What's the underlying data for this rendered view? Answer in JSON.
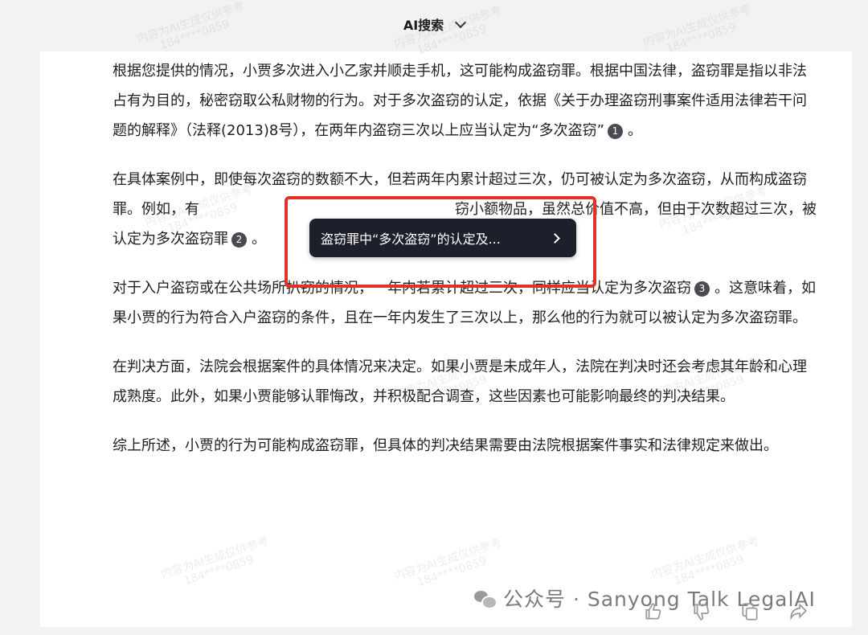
{
  "header": {
    "title": "AI搜索"
  },
  "answer": {
    "p1_text": "根据您提供的情况，小贾多次进入小乙家并顺走手机，这可能构成盗窃罪。根据中国法律，盗窃罪是指以非法占有为目的，秘密窃取公私财物的行为。对于多次盗窃的认定，依据《关于办理盗窃刑事案件适用法律若干问题的解释》（法释(2013)8号），在两年内盗窃三次以上应当认定为“多次盗窃”",
    "p1_cite": "1",
    "p1_end": "。",
    "p2_text_a": "在具体案例中，即使每次盗窃的数额不大，但若两年内累计超过三次，仍可被认定为多次盗窃，从而构成盗窃罪。例如，有",
    "p2_text_b": "窃小额物品，虽然总价值不高，但由于次数超过三次，被认定为多次盗窃罪",
    "p2_cite": "2",
    "p2_end": "。",
    "p3_text": "对于入户盗窃或在公共场所扒窃的情况，一年内若累计超过三次，同样应当认定为多次盗窃",
    "p3_cite": "3",
    "p3_end": "。这意味着，如果小贾的行为符合入户盗窃的条件，且在一年内发生了三次以上，那么他的行为就可以被认定为多次盗窃罪。",
    "p4_text": "在判决方面，法院会根据案件的具体情况来决定。如果小贾是未成年人，法院在判决时还会考虑其年龄和心理成熟度。此外，如果小贾能够认罪悔改，并积极配合调查，这些因素也可能影响最终的判决结果。",
    "p5_text": "综上所述，小贾的行为可能构成盗窃罪，但具体的判决结果需要由法院根据案件事实和法律规定来做出。"
  },
  "popup": {
    "label": "盗窃罪中“多次盗窃”的认定及..."
  },
  "watermark": {
    "line1": "内容为AI生成仅供参考",
    "line2": "184****0859"
  },
  "footer": {
    "brand": "公众号 · Sanyong Talk LegalAI"
  },
  "colors": {
    "highlight": "#e0312a",
    "popup_bg": "#1d1f2b",
    "cite_bg": "#4a4a52"
  },
  "icons": {
    "header": "chevron-down-icon",
    "popup": "chevron-right-icon",
    "footer": "wechat-icon",
    "actions": [
      "thumbs-up-icon",
      "thumbs-down-icon",
      "copy-icon",
      "share-icon"
    ]
  }
}
